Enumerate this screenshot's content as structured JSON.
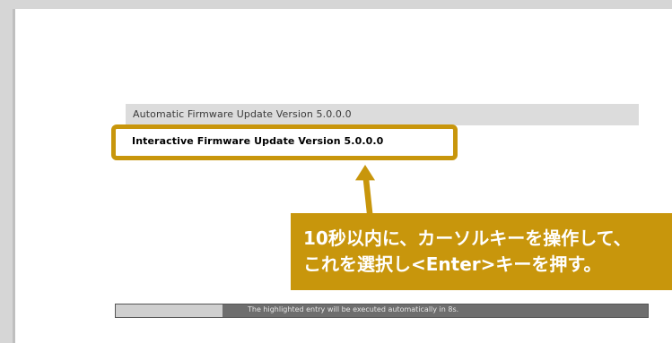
{
  "menu": {
    "items": [
      {
        "label": "Automatic Firmware Update Version 5.0.0.0"
      },
      {
        "label": "Interactive Firmware Update Version 5.0.0.0"
      }
    ]
  },
  "status": {
    "text": "The highlighted entry will be executed automatically in 8s.",
    "progress": 0.2
  },
  "callout": {
    "line1": "10秒以内に、カーソルキーを操作して、",
    "line2": "これを選択し<Enter>キーを押す。"
  },
  "colors": {
    "annotation": "#c8960c"
  }
}
